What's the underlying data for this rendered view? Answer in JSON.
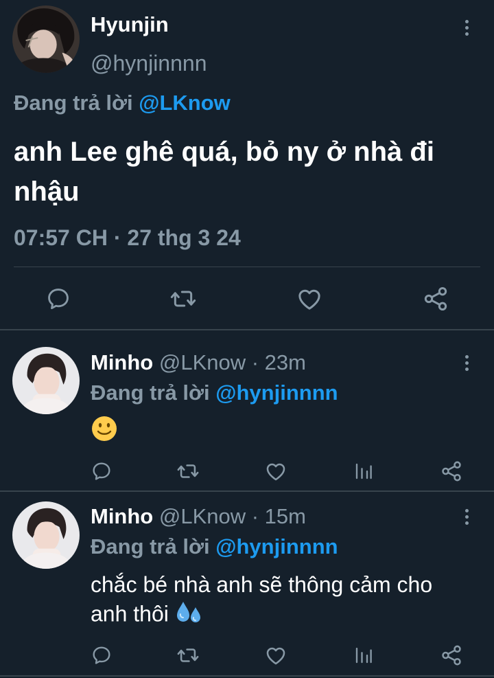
{
  "main_tweet": {
    "name": "Hyunjin",
    "handle": "@hynjinnnn",
    "replying_prefix": "Đang trả lời",
    "replying_to": "@LKnow",
    "text": "anh Lee ghê quá, bỏ ny ở nhà đi nhậu",
    "timestamp": "07:57 CH · 27 thg 3 24",
    "actions": [
      "reply-icon",
      "retweet-icon",
      "like-icon",
      "share-icon"
    ]
  },
  "replies": [
    {
      "name": "Minho",
      "handle_time": "@LKnow · 23m",
      "replying_prefix": "Đang trả lời",
      "replying_to": "@hynjinnnn",
      "text": "",
      "emoji": "slightly-smiling-face-emoji",
      "actions": [
        "reply-icon",
        "retweet-icon",
        "like-icon",
        "analytics-icon",
        "share-icon"
      ]
    },
    {
      "name": "Minho",
      "handle_time": "@LKnow · 15m",
      "replying_prefix": "Đang trả lời",
      "replying_to": "@hynjinnnn",
      "text": "chắc bé nhà anh sẽ thông cảm cho anh thôi",
      "emoji": "sweat-droplets-emoji",
      "actions": [
        "reply-icon",
        "retweet-icon",
        "like-icon",
        "analytics-icon",
        "share-icon"
      ]
    }
  ],
  "colors": {
    "background": "#15202b",
    "muted": "#8899a6",
    "link": "#1d9bf0",
    "divider": "#38444d"
  }
}
